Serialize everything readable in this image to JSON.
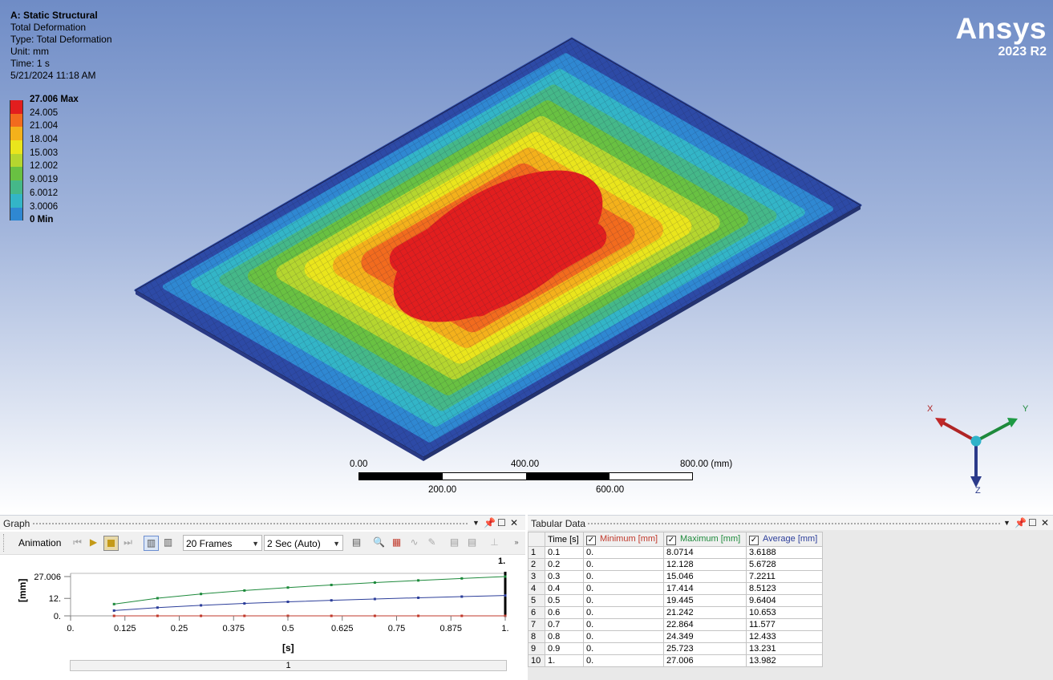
{
  "analysis": {
    "title": "A: Static Structural",
    "result": "Total Deformation",
    "type": "Type: Total Deformation",
    "unit": "Unit: mm",
    "time": "Time: 1 s",
    "date": "5/21/2024 11:18 AM"
  },
  "legend": [
    {
      "label": "27.006 Max",
      "color": "#e21e1e",
      "bold": true
    },
    {
      "label": "24.005",
      "color": "#f26b1e"
    },
    {
      "label": "21.004",
      "color": "#f4b11b"
    },
    {
      "label": "18.004",
      "color": "#eae51c"
    },
    {
      "label": "15.003",
      "color": "#b5d62f"
    },
    {
      "label": "12.002",
      "color": "#69c142"
    },
    {
      "label": "9.0019",
      "color": "#45b889"
    },
    {
      "label": "6.0012",
      "color": "#33b5c7"
    },
    {
      "label": "3.0006",
      "color": "#2f88d2"
    },
    {
      "label": "0 Min",
      "color": "#2d4aa6",
      "bold": true
    }
  ],
  "logo": {
    "brand": "Ansys",
    "version": "2023 R2"
  },
  "scale_bar": {
    "top_labels": [
      "0.00",
      "400.00",
      "800.00 (mm)"
    ],
    "bottom_labels": [
      "200.00",
      "600.00"
    ]
  },
  "triad": {
    "x": "X",
    "y": "Y",
    "z": "Z"
  },
  "graph": {
    "title": "Graph",
    "animation_label": "Animation",
    "frames": "20 Frames",
    "duration": "2 Sec (Auto)",
    "y_axis_label": "[mm]",
    "x_axis_label": "[s]",
    "y_ticks": [
      "27.006",
      "12.",
      "0."
    ],
    "x_ticks": [
      "0.",
      "0.125",
      "0.25",
      "0.375",
      "0.5",
      "0.625",
      "0.75",
      "0.875",
      "1."
    ],
    "cursor_label": "1.",
    "timeline_label": "1"
  },
  "chart_data": {
    "type": "line",
    "x": [
      0.1,
      0.2,
      0.3,
      0.4,
      0.5,
      0.6,
      0.7,
      0.8,
      0.9,
      1.0
    ],
    "ylim": [
      0,
      27.006
    ],
    "xlim": [
      0,
      1
    ],
    "series": [
      {
        "name": "Minimum [mm]",
        "color": "#c0392b",
        "values": [
          0,
          0,
          0,
          0,
          0,
          0,
          0,
          0,
          0,
          0
        ]
      },
      {
        "name": "Maximum [mm]",
        "color": "#1e8a3c",
        "values": [
          8.0714,
          12.128,
          15.046,
          17.414,
          19.445,
          21.242,
          22.864,
          24.349,
          25.723,
          27.006
        ]
      },
      {
        "name": "Average [mm]",
        "color": "#2c3e9a",
        "values": [
          3.6188,
          5.6728,
          7.2211,
          8.5123,
          9.6404,
          10.653,
          11.577,
          12.433,
          13.231,
          13.982
        ]
      }
    ]
  },
  "tabular": {
    "title": "Tabular Data",
    "headers": {
      "time": "Time [s]",
      "min": "Minimum [mm]",
      "max": "Maximum [mm]",
      "avg": "Average [mm]"
    },
    "header_colors": {
      "min": "#c0392b",
      "max": "#1e8a3c",
      "avg": "#2c3e9a"
    },
    "rows": [
      {
        "idx": "1",
        "time": "0.1",
        "min": "0.",
        "max": "8.0714",
        "avg": "3.6188"
      },
      {
        "idx": "2",
        "time": "0.2",
        "min": "0.",
        "max": "12.128",
        "avg": "5.6728"
      },
      {
        "idx": "3",
        "time": "0.3",
        "min": "0.",
        "max": "15.046",
        "avg": "7.2211"
      },
      {
        "idx": "4",
        "time": "0.4",
        "min": "0.",
        "max": "17.414",
        "avg": "8.5123"
      },
      {
        "idx": "5",
        "time": "0.5",
        "min": "0.",
        "max": "19.445",
        "avg": "9.6404"
      },
      {
        "idx": "6",
        "time": "0.6",
        "min": "0.",
        "max": "21.242",
        "avg": "10.653"
      },
      {
        "idx": "7",
        "time": "0.7",
        "min": "0.",
        "max": "22.864",
        "avg": "11.577"
      },
      {
        "idx": "8",
        "time": "0.8",
        "min": "0.",
        "max": "24.349",
        "avg": "12.433"
      },
      {
        "idx": "9",
        "time": "0.9",
        "min": "0.",
        "max": "25.723",
        "avg": "13.231"
      },
      {
        "idx": "10",
        "time": "1.",
        "min": "0.",
        "max": "27.006",
        "avg": "13.982"
      }
    ]
  }
}
